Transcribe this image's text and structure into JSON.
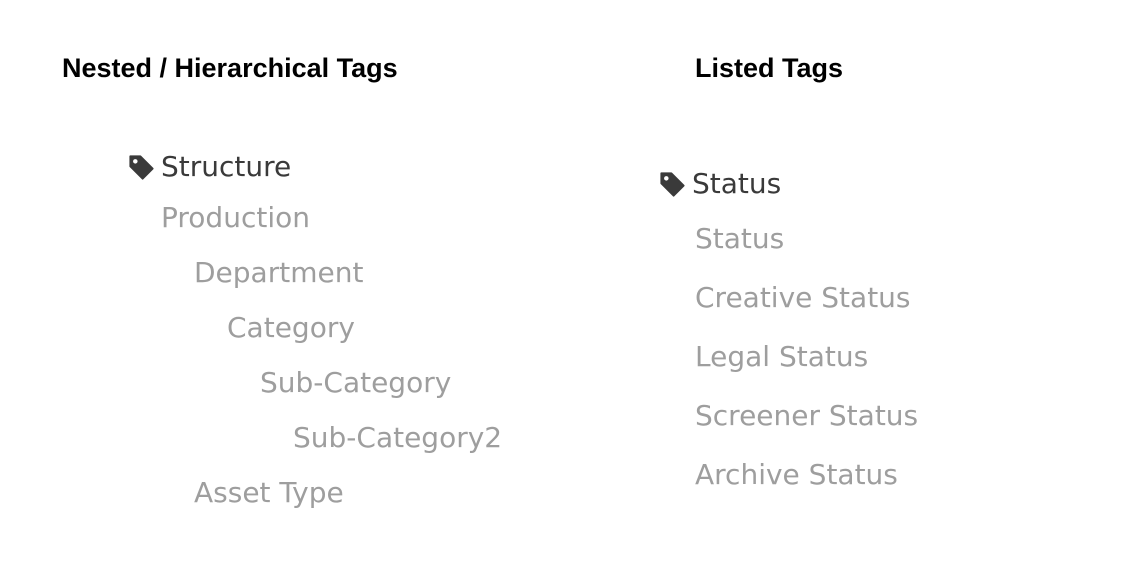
{
  "nested": {
    "heading": "Nested / Hierarchical Tags",
    "root_label": "Structure",
    "root_icon": "tag-icon",
    "items": [
      {
        "label": "Production",
        "depth": 0
      },
      {
        "label": "Department",
        "depth": 1
      },
      {
        "label": "Category",
        "depth": 2
      },
      {
        "label": "Sub-Category",
        "depth": 3
      },
      {
        "label": "Sub-Category2",
        "depth": 4
      },
      {
        "label": "Asset Type",
        "depth": 1
      }
    ]
  },
  "listed": {
    "heading": "Listed Tags",
    "root_label": "Status",
    "root_icon": "tag-icon",
    "items": [
      {
        "label": "Status"
      },
      {
        "label": "Creative Status"
      },
      {
        "label": "Legal Status"
      },
      {
        "label": "Screener Status"
      },
      {
        "label": "Archive Status"
      }
    ]
  },
  "colors": {
    "heading": "#000000",
    "root_label": "#3a3a3a",
    "item": "#9e9e9e",
    "icon": "#3a3a3a"
  }
}
